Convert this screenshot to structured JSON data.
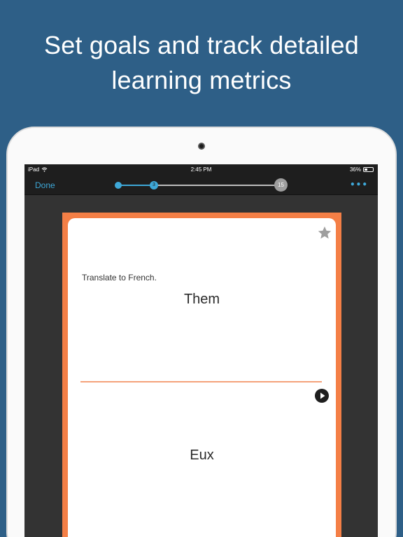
{
  "headline": {
    "line1": "Set goals and track detailed",
    "line2": "learning metrics"
  },
  "status_bar": {
    "device": "iPad",
    "time": "2:45 PM",
    "battery": "36%"
  },
  "nav": {
    "done_label": "Done",
    "current_card": "3",
    "total_cards": "15",
    "progress_fraction": 0.2,
    "more_label": "•••"
  },
  "card": {
    "prompt": "Translate to French.",
    "term": "Them",
    "definition": "Eux",
    "starred": false
  },
  "colors": {
    "background": "#2e5f87",
    "accent": "#3ea8d8",
    "card_border": "#f47f46"
  },
  "icons": [
    "wifi-icon",
    "battery-icon",
    "star-icon",
    "play-icon"
  ]
}
